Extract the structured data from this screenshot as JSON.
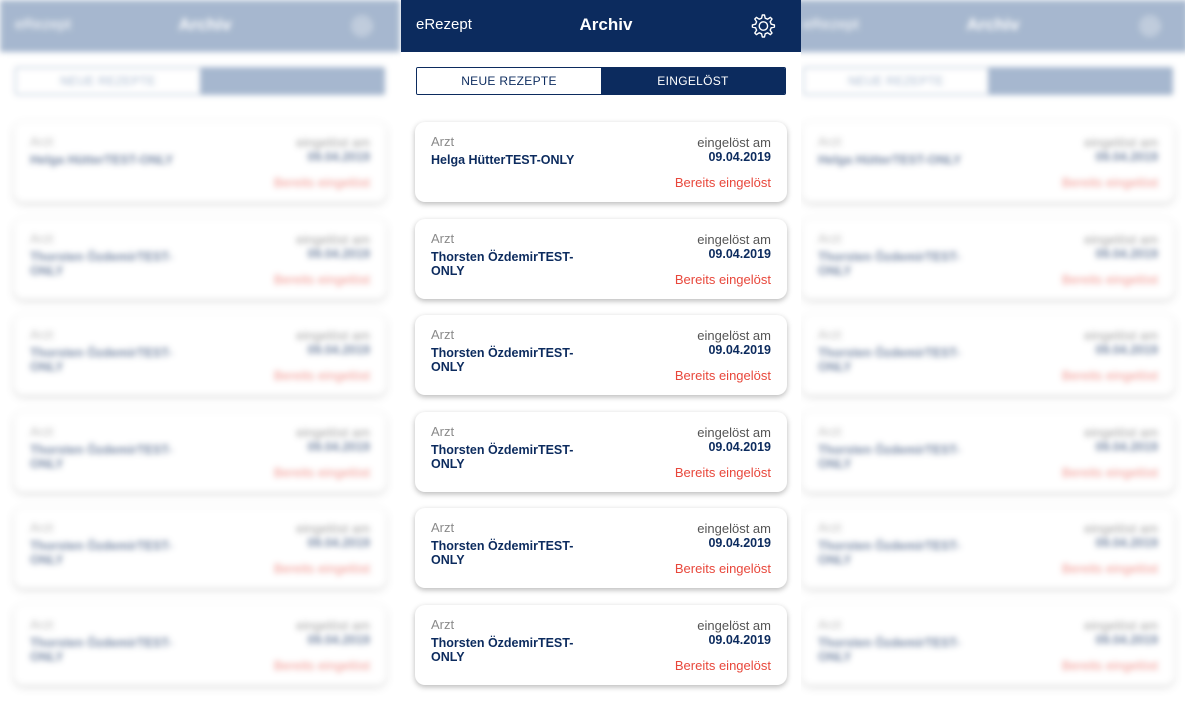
{
  "header": {
    "brand": "eRezept",
    "title": "Archiv",
    "settings_icon": "gear-icon"
  },
  "tabs": [
    {
      "label": "NEUE REZEPTE",
      "active": false
    },
    {
      "label": "EINGELÖST",
      "active": true
    }
  ],
  "list": {
    "items": [
      {
        "arzt_label": "Arzt",
        "doctor": "Helga HütterTEST-ONLY",
        "redeemed_label": "eingelöst am",
        "date": "09.04.2019",
        "status": "Bereits eingelöst"
      },
      {
        "arzt_label": "Arzt",
        "doctor": "Thorsten ÖzdemirTEST-ONLY",
        "redeemed_label": "eingelöst am",
        "date": "09.04.2019",
        "status": "Bereits eingelöst"
      },
      {
        "arzt_label": "Arzt",
        "doctor": "Thorsten ÖzdemirTEST-ONLY",
        "redeemed_label": "eingelöst am",
        "date": "09.04.2019",
        "status": "Bereits eingelöst"
      },
      {
        "arzt_label": "Arzt",
        "doctor": "Thorsten ÖzdemirTEST-ONLY",
        "redeemed_label": "eingelöst am",
        "date": "09.04.2019",
        "status": "Bereits eingelöst"
      },
      {
        "arzt_label": "Arzt",
        "doctor": "Thorsten ÖzdemirTEST-ONLY",
        "redeemed_label": "eingelöst am",
        "date": "09.04.2019",
        "status": "Bereits eingelöst"
      },
      {
        "arzt_label": "Arzt",
        "doctor": "Thorsten ÖzdemirTEST-ONLY",
        "redeemed_label": "eingelöst am",
        "date": "09.04.2019",
        "status": "Bereits eingelöst"
      }
    ]
  }
}
